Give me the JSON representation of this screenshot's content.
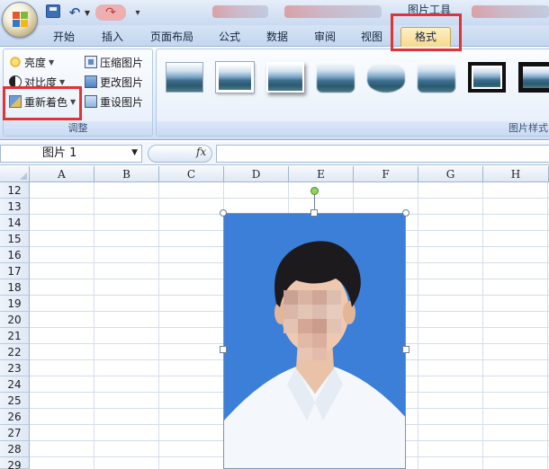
{
  "titlebar": {
    "context_tool_title": "图片工具",
    "quick_access": {
      "save_icon": "save-icon",
      "undo_icon": "undo-icon",
      "redo_icon": "redo-icon",
      "more_icon": "chevron-down-icon"
    }
  },
  "tabs": [
    {
      "label": "开始"
    },
    {
      "label": "插入"
    },
    {
      "label": "页面布局"
    },
    {
      "label": "公式"
    },
    {
      "label": "数据"
    },
    {
      "label": "审阅"
    },
    {
      "label": "视图"
    },
    {
      "label": "格式",
      "active": true
    }
  ],
  "ribbon": {
    "adjust_group": {
      "label": "调整",
      "brightness": "亮度",
      "contrast": "对比度",
      "recolor": "重新着色",
      "compress": "压缩图片",
      "change_picture": "更改图片",
      "reset_picture": "重设图片"
    },
    "styles_group": {
      "label": "图片样式"
    }
  },
  "formula_bar": {
    "name_box": "图片 1",
    "fx_label": "fx",
    "formula_value": ""
  },
  "sheet": {
    "columns": [
      "A",
      "B",
      "C",
      "D",
      "E",
      "F",
      "G",
      "H"
    ],
    "rows": [
      "12",
      "13",
      "14",
      "15",
      "16",
      "17",
      "18",
      "19",
      "20",
      "21",
      "22",
      "23",
      "24",
      "25",
      "26",
      "27",
      "28",
      "29"
    ]
  },
  "colors": {
    "highlight": "#e03333",
    "photo_background": "#3b7fd9",
    "ribbon_blue": "#dfeafa"
  }
}
